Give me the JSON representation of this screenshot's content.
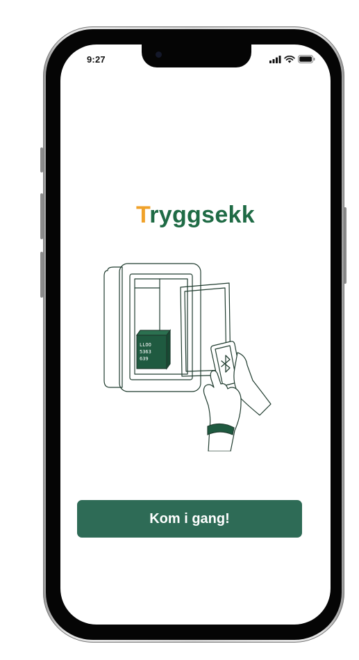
{
  "status_bar": {
    "time": "9:27",
    "icons": [
      "cellular-signal-icon",
      "wifi-icon",
      "battery-icon"
    ]
  },
  "logo": {
    "first_letter": "T",
    "rest": "ryggsekk"
  },
  "illustration": {
    "box_label_line1": "LLOO",
    "box_label_line2": "5363",
    "box_label_line3": "639",
    "icon": "bluetooth-icon"
  },
  "cta": {
    "label": "Kom i gang!"
  },
  "colors": {
    "brand_green": "#1f6b45",
    "brand_orange": "#f0a22a",
    "button_green": "#2e6b56"
  }
}
